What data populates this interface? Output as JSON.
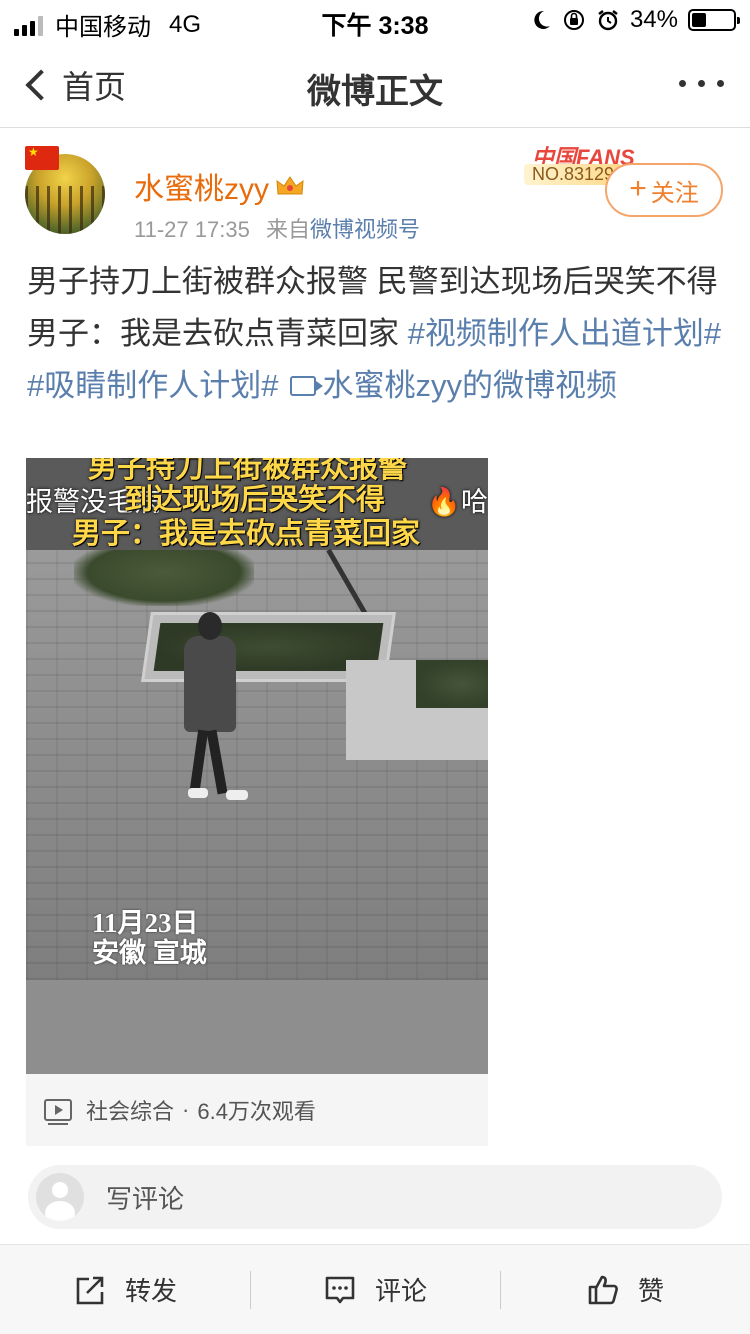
{
  "status_bar": {
    "carrier": "中国移动",
    "network": "4G",
    "time": "下午 3:38",
    "battery": "34%",
    "battery_level": 0.34
  },
  "nav": {
    "back_label": "首页",
    "title": "微博正文"
  },
  "author": {
    "name": "水蜜桃zyy",
    "time": "11-27 17:35",
    "from_prefix": "来自",
    "source": "微博视频号",
    "fans_badge_logo": "中国FANS",
    "fans_badge_no": "NO.83129",
    "follow_label": "关注"
  },
  "post": {
    "text_plain": "男子持刀上街被群众报警 民警到达现场后哭笑不得 男子：我是去砍点青菜回家 ",
    "topic1": "#视频制作人出道计划#",
    "topic2": "#吸睛制作人计划#",
    "video_link": "水蜜桃zyy的微博视频"
  },
  "video": {
    "caption_line1": "男子持刀上街被群众报警",
    "caption_line2": "到达现场后哭笑不得",
    "caption_line3": "男子：我是去砍点青菜回家",
    "danmu_left": "报警没毛病",
    "danmu_right": "🔥哈",
    "overlay_date": "11月23日",
    "overlay_place": "安徽 宣城",
    "category": "社会综合",
    "separator": "·",
    "views": "6.4万次观看"
  },
  "comment_input": {
    "placeholder": "写评论"
  },
  "toolbar": {
    "repost_label": "转发",
    "comment_label": "评论",
    "like_label": "赞"
  }
}
